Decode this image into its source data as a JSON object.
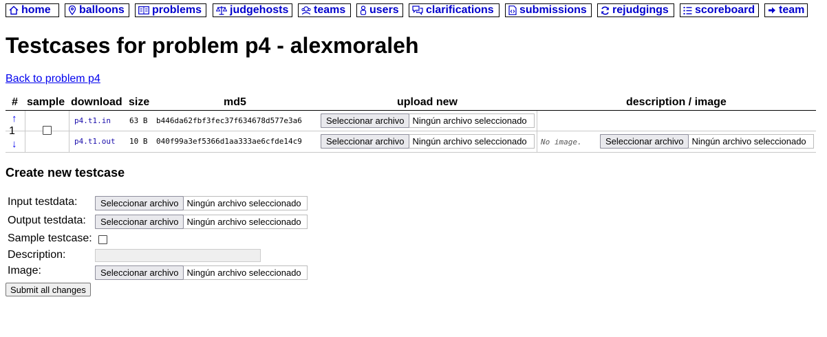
{
  "nav": {
    "home": "home",
    "balloons": "balloons",
    "problems": "problems",
    "judgehosts": "judgehosts",
    "teams": "teams",
    "users": "users",
    "clarifications": "clarifications",
    "submissions": "submissions",
    "rejudgings": "rejudgings",
    "scoreboard": "scoreboard",
    "team": "team"
  },
  "page_title": "Testcases for problem p4 - alexmoraleh",
  "back_link": "Back to problem p4",
  "table": {
    "headers": {
      "rank": "#",
      "sample": "sample",
      "download": "download",
      "size": "size",
      "md5": "md5",
      "upload_new": "upload new",
      "description_image": "description / image"
    },
    "testcases": [
      {
        "rank": "1",
        "up_arrow": "↑",
        "down_arrow": "↓",
        "sample": false,
        "input": {
          "filename": "p4.t1.in",
          "size": "63 B",
          "md5": "b446da62fbf3fec37f634678d577e3a6"
        },
        "output": {
          "filename": "p4.t1.out",
          "size": "10 B",
          "md5": "040f99a3ef5366d1aa333ae6cfde14c9"
        },
        "no_image_text": "No image."
      }
    ]
  },
  "file_input": {
    "button": "Seleccionar archivo",
    "status": "Ningún archivo seleccionado"
  },
  "create": {
    "heading": "Create new testcase",
    "input_label": "Input testdata:",
    "output_label": "Output testdata:",
    "sample_label": "Sample testcase:",
    "description_label": "Description:",
    "image_label": "Image:",
    "submit": "Submit all changes"
  },
  "colors": {
    "nav_link": "#0000cc",
    "link": "#0000ee",
    "file_button_bg": "#e9e9ed"
  }
}
